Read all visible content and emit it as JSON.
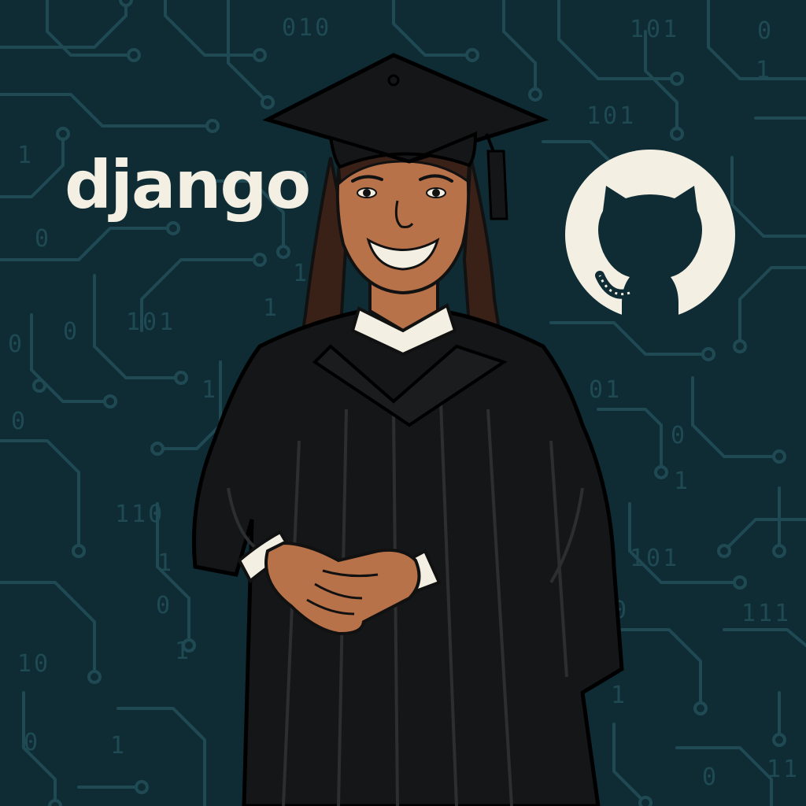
{
  "logos": {
    "django_text": "django",
    "github_logo": "github-octocat-logo"
  },
  "background": {
    "circuit_color": "#1f4a54",
    "base_color": "#0f2c35",
    "binary_labels": [
      "010",
      "101",
      "1",
      "0",
      "101",
      "1",
      "0",
      "1",
      "0",
      "101",
      "0",
      "1",
      "01",
      "0",
      "0",
      "1",
      "110",
      "1",
      "0",
      "1",
      "10",
      "0",
      "1",
      "101",
      "0",
      "111",
      "1",
      "1",
      "0",
      "0",
      "11"
    ]
  },
  "colors": {
    "gown": "#151617",
    "skin": "#b8724a",
    "hair": "#3a2118",
    "collar": "#f3efe3",
    "logo_light": "#f3efe3"
  },
  "figure": {
    "subject": "graduate-in-cap-and-gown"
  }
}
